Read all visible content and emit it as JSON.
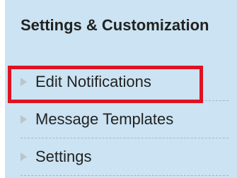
{
  "section": {
    "title": "Settings & Customization"
  },
  "menu": {
    "items": [
      {
        "label": "Edit Notifications",
        "icon": "arrow-right-icon",
        "highlighted": true
      },
      {
        "label": "Message Templates",
        "icon": "arrow-right-icon",
        "highlighted": false
      },
      {
        "label": "Settings",
        "icon": "arrow-right-icon",
        "highlighted": false
      }
    ]
  },
  "colors": {
    "panel_background": "#cbe3f2",
    "highlight_border": "#e01221",
    "text": "#222222",
    "arrow": "#b9c4cc"
  }
}
